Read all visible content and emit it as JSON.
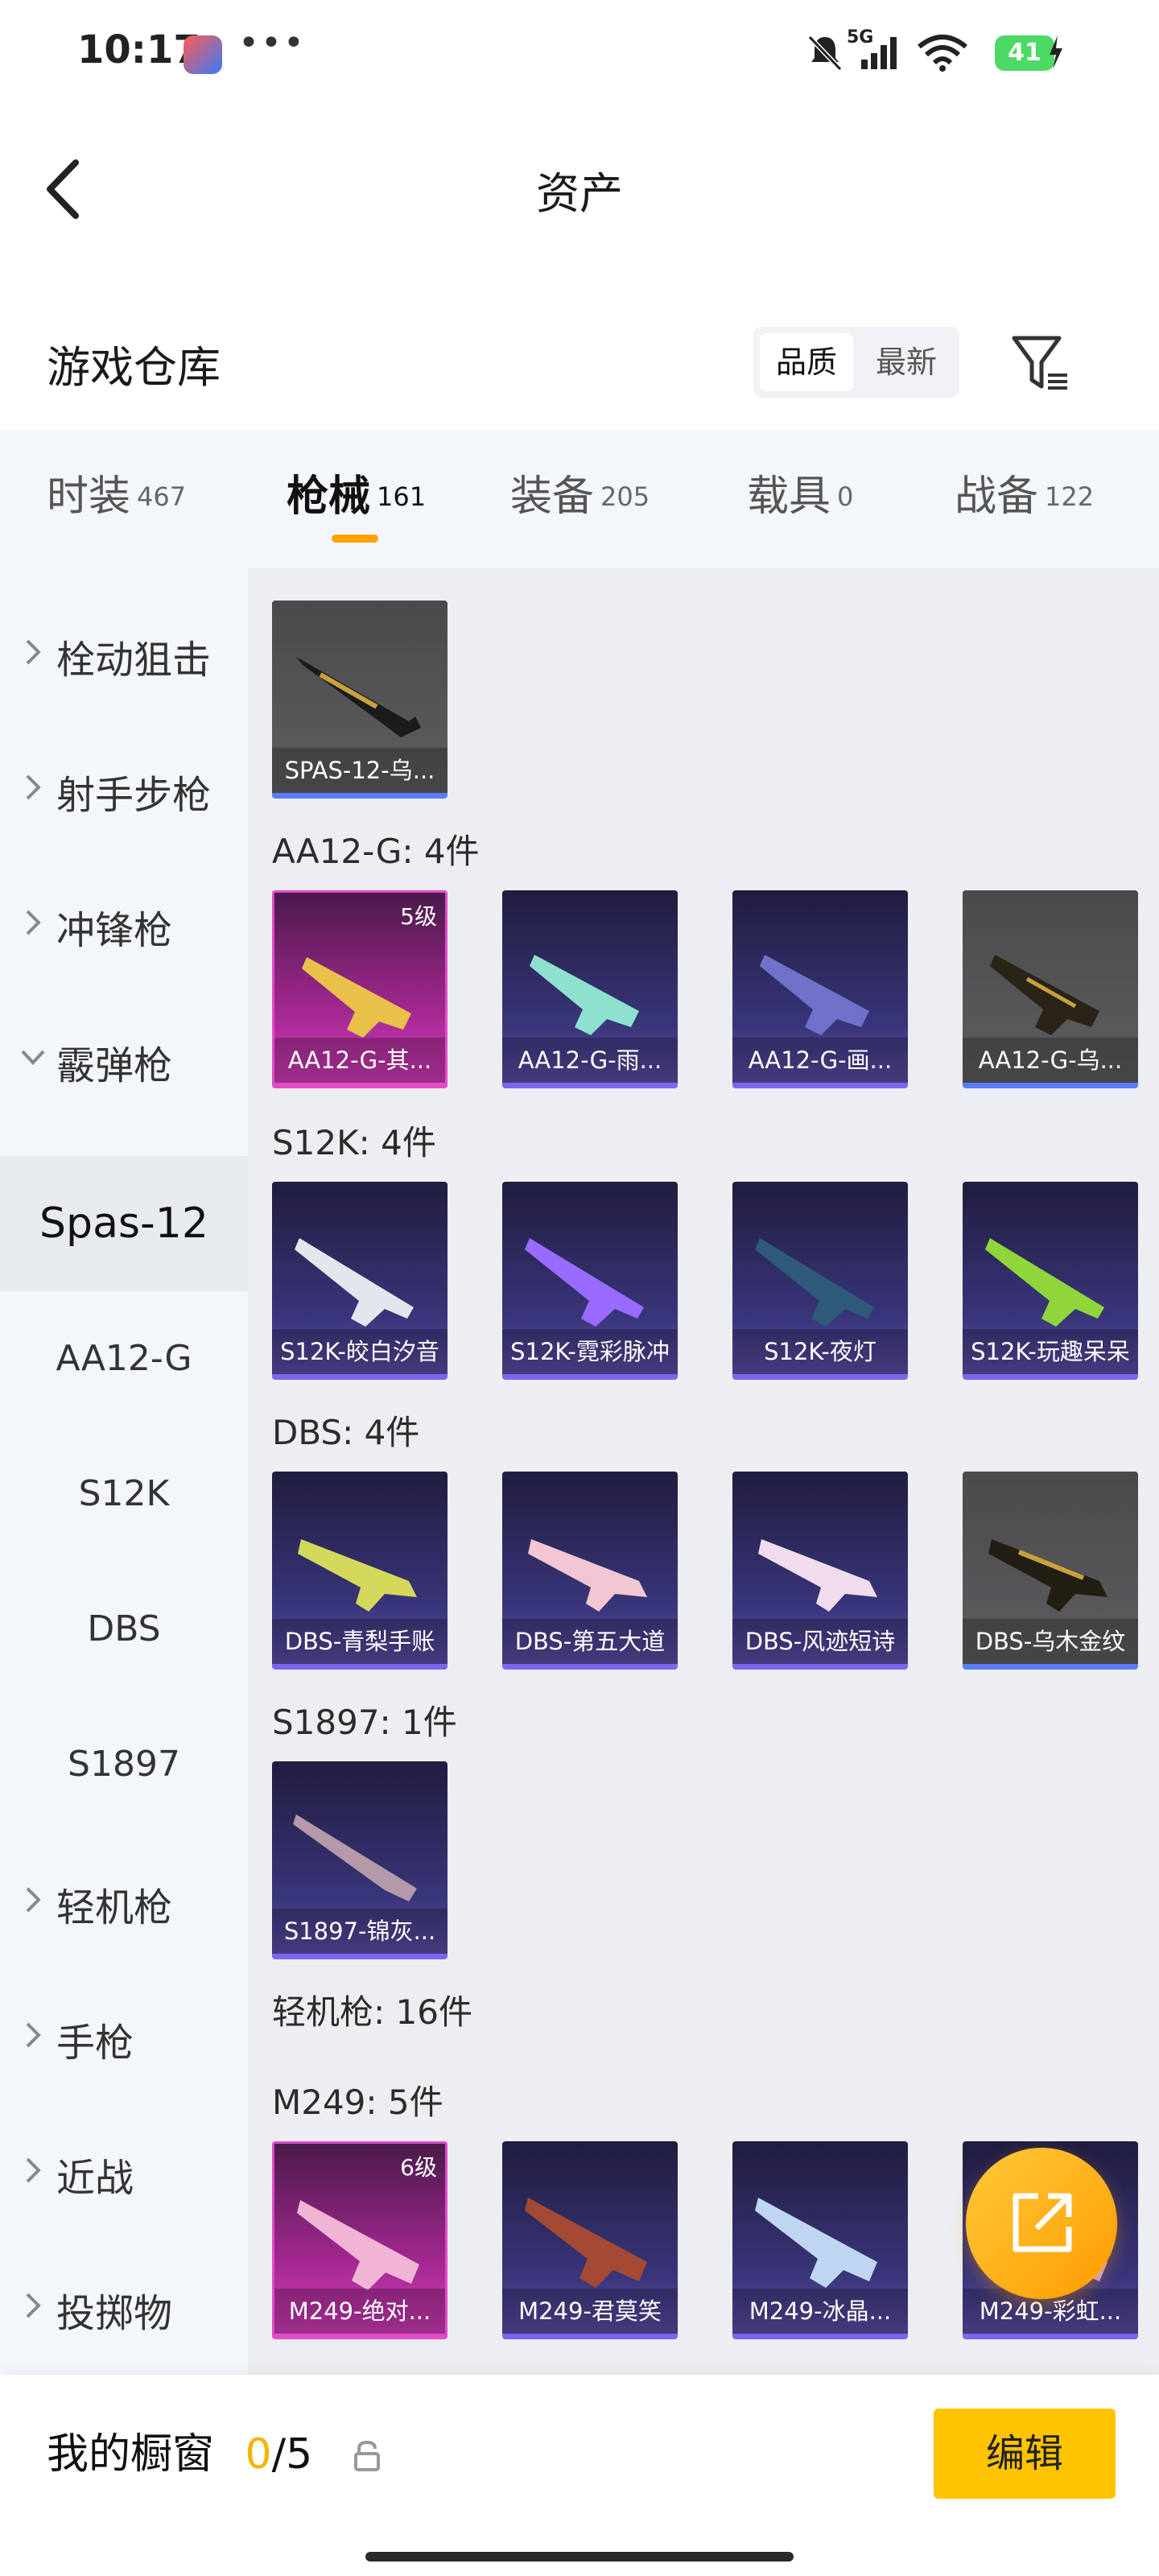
{
  "status_bar": {
    "time": "10:17",
    "dots": "•••",
    "network": "5G",
    "battery": "41"
  },
  "nav": {
    "title": "资产"
  },
  "warehouse": {
    "title": "游戏仓库",
    "sort_options": [
      "品质",
      "最新"
    ],
    "active_sort": "品质"
  },
  "tabs": [
    {
      "label": "时装",
      "count": "467"
    },
    {
      "label": "枪械",
      "count": "161"
    },
    {
      "label": "装备",
      "count": "205"
    },
    {
      "label": "载具",
      "count": "0"
    },
    {
      "label": "战备",
      "count": "122"
    }
  ],
  "sidebar": {
    "categories": [
      {
        "label": "栓动狙击"
      },
      {
        "label": "射手步枪"
      },
      {
        "label": "冲锋枪"
      },
      {
        "label": "霰弹枪"
      }
    ],
    "subitems": [
      {
        "label": "Spas-12"
      },
      {
        "label": "AA12-G"
      },
      {
        "label": "S12K"
      },
      {
        "label": "DBS"
      },
      {
        "label": "S1897"
      }
    ],
    "categories_after": [
      {
        "label": "轻机枪"
      },
      {
        "label": "手枪"
      },
      {
        "label": "近战"
      },
      {
        "label": "投掷物"
      }
    ]
  },
  "content": {
    "spas_item": "SPAS-12-乌...",
    "sections": {
      "aa12": "AA12-G: 4件",
      "s12k": "S12K: 4件",
      "dbs": "DBS: 4件",
      "s1897": "S1897: 1件",
      "lmg": "轻机枪: 16件",
      "m249": "M249: 5件"
    },
    "aa12_items": [
      {
        "name": "AA12-G-其...",
        "level": "5级"
      },
      {
        "name": "AA12-G-雨..."
      },
      {
        "name": "AA12-G-画..."
      },
      {
        "name": "AA12-G-乌..."
      }
    ],
    "s12k_items": [
      {
        "name": "S12K-皎白汐音"
      },
      {
        "name": "S12K-霓彩脉冲"
      },
      {
        "name": "S12K-夜灯"
      },
      {
        "name": "S12K-玩趣呆呆"
      }
    ],
    "dbs_items": [
      {
        "name": "DBS-青梨手账"
      },
      {
        "name": "DBS-第五大道"
      },
      {
        "name": "DBS-风迹短诗"
      },
      {
        "name": "DBS-乌木金纹"
      }
    ],
    "s1897_items": [
      {
        "name": "S1897-锦灰..."
      }
    ],
    "m249_items": [
      {
        "name": "M249-绝对...",
        "level": "6级"
      },
      {
        "name": "M249-君莫笑"
      },
      {
        "name": "M249-冰晶..."
      },
      {
        "name": "M249-彩虹..."
      }
    ]
  },
  "bottom": {
    "label": "我的橱窗",
    "used": "0",
    "sep": "/",
    "total": "5",
    "edit": "编辑"
  },
  "colors": {
    "accent": "#ffc400",
    "underline": "#ffa200",
    "purple_card": "#39357a",
    "pink_card": "#a0278e",
    "gray_card": "#5e5e62"
  }
}
